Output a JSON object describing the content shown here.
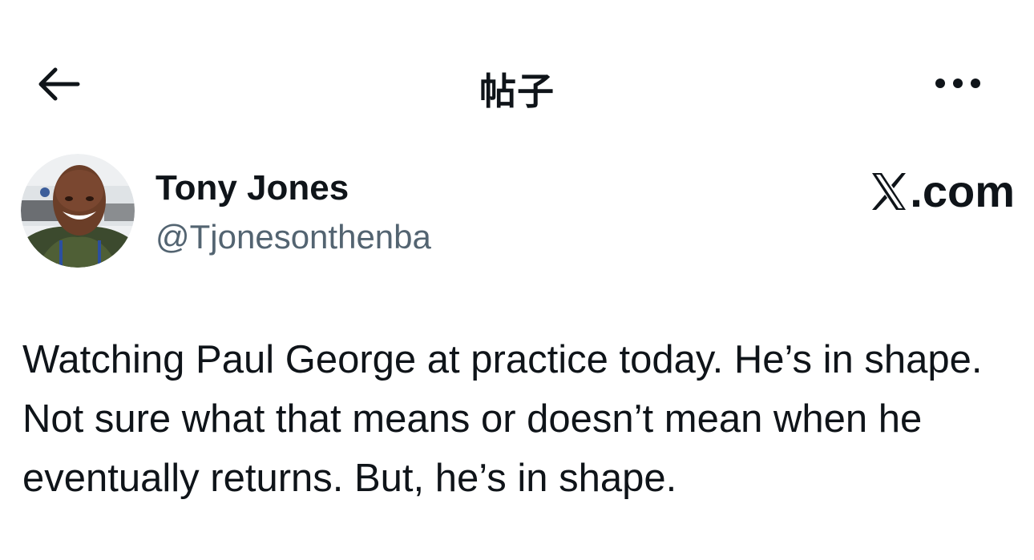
{
  "header": {
    "title": "帖子",
    "back_icon": "arrow-left-icon",
    "more_icon": "more-horizontal-icon"
  },
  "author": {
    "display_name": "Tony Jones",
    "handle": "@Tjonesonthenba",
    "avatar_icon": "avatar"
  },
  "site": {
    "logo_text": ".com",
    "logo_icon": "x-logo-icon"
  },
  "post": {
    "text": "Watching Paul George at practice today. He’s in shape. Not sure what that means or doesn’t mean when he eventually returns. But, he’s in shape."
  },
  "colors": {
    "text_primary": "#0f1419",
    "text_secondary": "#536471",
    "background": "#ffffff"
  }
}
